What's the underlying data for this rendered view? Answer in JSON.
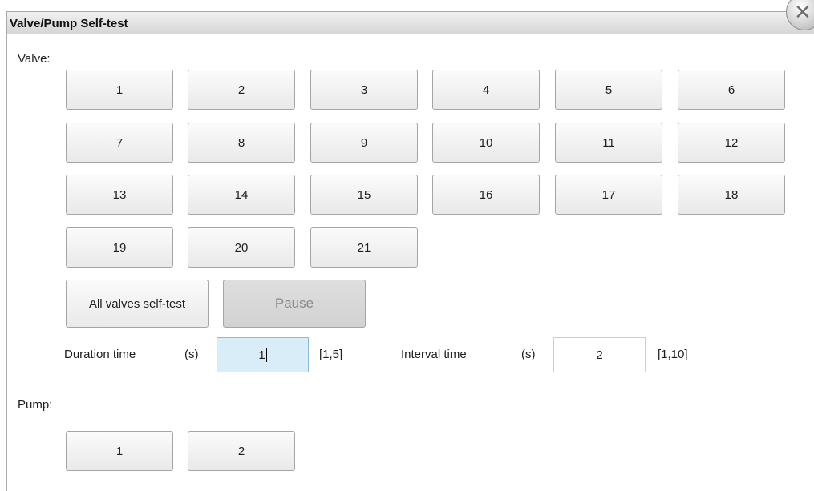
{
  "dialog": {
    "title": "Valve/Pump Self-test",
    "close_icon": "close-icon"
  },
  "valve": {
    "label": "Valve:",
    "buttons": [
      "1",
      "2",
      "3",
      "4",
      "5",
      "6",
      "7",
      "8",
      "9",
      "10",
      "11",
      "12",
      "13",
      "14",
      "15",
      "16",
      "17",
      "18",
      "19",
      "20",
      "21"
    ],
    "all_self_test_label": "All valves self-test",
    "pause_label": "Pause"
  },
  "params": {
    "duration_label": "Duration time",
    "duration_unit": "(s)",
    "duration_value": "1",
    "duration_range": "[1,5]",
    "interval_label": "Interval time",
    "interval_unit": "(s)",
    "interval_value": "2",
    "interval_range": "[1,10]"
  },
  "pump": {
    "label": "Pump:",
    "buttons": [
      "1",
      "2"
    ]
  },
  "colors": {
    "title_bar": "#dcdcdc",
    "button_face": "#f3f3f3",
    "button_border": "#a5a5a5",
    "disabled_button": "#d8d8d8",
    "active_field": "#d9edf9"
  }
}
